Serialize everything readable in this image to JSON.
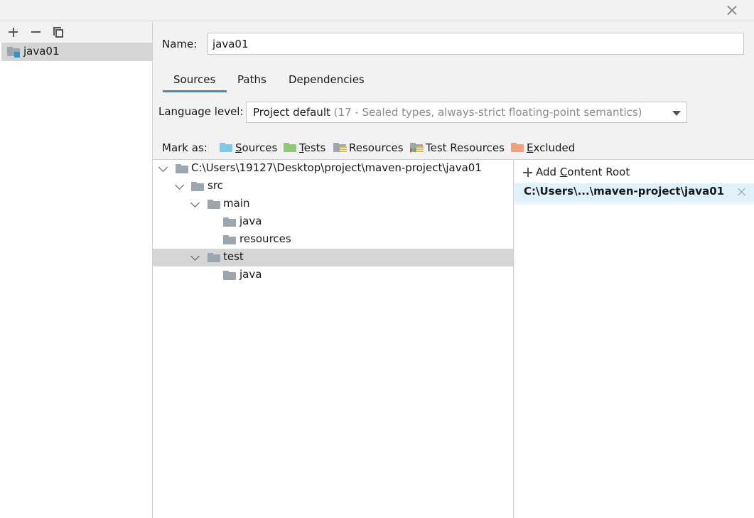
{
  "window": {
    "close_icon": "close-icon"
  },
  "left_toolbar": {
    "add_icon": "plus-icon",
    "remove_icon": "minus-icon",
    "copy_icon": "copy-icon"
  },
  "modules": [
    {
      "label": "java01",
      "icon": "module-folder-icon"
    }
  ],
  "name_field": {
    "label": "Name:",
    "value": "java01"
  },
  "tabs": [
    {
      "label": "Sources",
      "active": true
    },
    {
      "label": "Paths"
    },
    {
      "label": "Dependencies"
    }
  ],
  "language_level": {
    "label": "Language level:",
    "selected_main": "Project default",
    "selected_hint": "(17 - Sealed types, always-strict floating-point semantics)"
  },
  "mark_as": {
    "label": "Mark as:",
    "items": [
      {
        "label_first": "S",
        "label_rest": "ources",
        "color": "#7ec8e8"
      },
      {
        "label_first": "T",
        "label_rest": "ests",
        "color": "#8fcb76"
      },
      {
        "label_first": "",
        "label_rest": "Resources",
        "color": "#9aa7b0"
      },
      {
        "label_first": "",
        "label_rest": "Test Resources",
        "color": "#9aa7b0"
      },
      {
        "label_first": "E",
        "label_rest": "xcluded",
        "color": "#f0a07a"
      }
    ]
  },
  "tree": [
    {
      "label": "C:\\Users\\19127\\Desktop\\project\\maven-project\\java01",
      "expanded": true
    },
    {
      "label": "src",
      "expanded": true
    },
    {
      "label": "main",
      "expanded": true
    },
    {
      "label": "java"
    },
    {
      "label": "resources"
    },
    {
      "label": "test",
      "expanded": true,
      "selected": true
    },
    {
      "label": "java"
    }
  ],
  "content_roots": {
    "add_label_prefix": "Add ",
    "add_label_underlined": "C",
    "add_label_rest": "ontent Root",
    "items": [
      {
        "label": "C:\\Users\\...\\maven-project\\java01"
      }
    ]
  }
}
